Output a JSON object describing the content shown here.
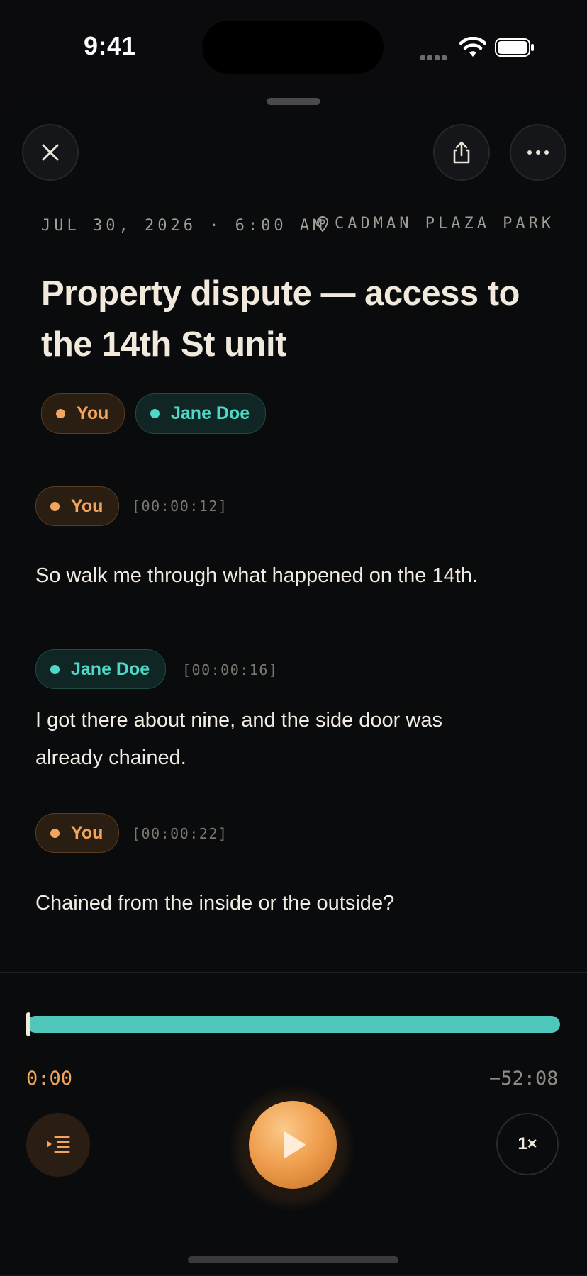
{
  "status_bar": {
    "time": "9:41"
  },
  "header": {
    "close_icon": "close-icon",
    "share_icon": "share-icon",
    "more_icon": "more-icon"
  },
  "recording": {
    "date_time": "JUL 30, 2026 · 6:00 AM",
    "location": "CADMAN PLAZA PARK",
    "title": "Property dispute — access to the 14th St unit",
    "participants": [
      {
        "name": "You",
        "color": "#f2a55c"
      },
      {
        "name": "Jane Doe",
        "color": "#4fd8c9"
      }
    ]
  },
  "transcript": [
    {
      "speaker": "You",
      "timestamp": "[00:00:12]",
      "text": "So walk me through what happened on the 14th."
    },
    {
      "speaker": "Jane Doe",
      "timestamp": "[00:00:16]",
      "text": "I got there about nine, and the side door was already chained."
    },
    {
      "speaker": "You",
      "timestamp": "[00:00:22]",
      "text": "Chained from the inside or the outside?"
    }
  ],
  "player": {
    "elapsed": "0:00",
    "remaining": "−52:08",
    "progress_fraction": 0,
    "speed": "1×",
    "play_icon": "play-icon",
    "chapters_icon": "chapters-list-icon"
  },
  "colors": {
    "accent_orange": "#f2a55c",
    "accent_teal": "#4fd8c9",
    "background": "#0a0b0d"
  }
}
